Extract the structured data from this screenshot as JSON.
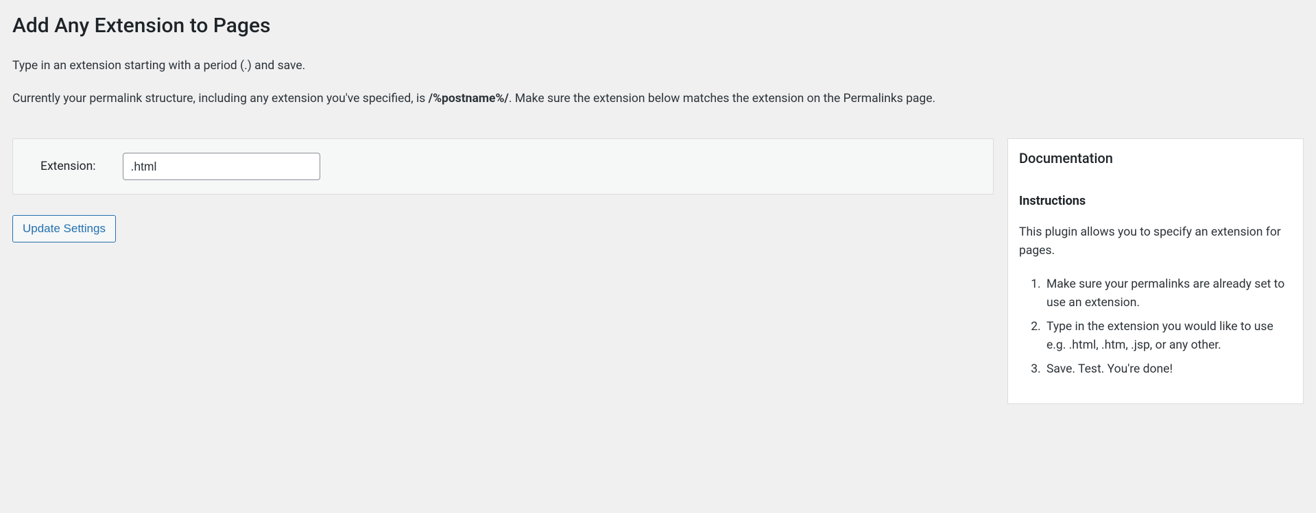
{
  "page": {
    "title": "Add Any Extension to Pages",
    "intro_line1": "Type in an extension starting with a period (.) and save.",
    "intro_line2_prefix": "Currently your permalink structure, including any extension you've specified, is ",
    "permalink_structure": "/%postname%/",
    "intro_line2_suffix": ". Make sure the extension below matches the extension on the Permalinks page."
  },
  "form": {
    "extension_label": "Extension:",
    "extension_value": ".html",
    "update_button_label": "Update Settings"
  },
  "doc": {
    "title": "Documentation",
    "subtitle": "Instructions",
    "description": "This plugin allows you to specify an extension for pages.",
    "steps": [
      "Make sure your permalinks are already set to use an extension.",
      "Type in the extension you would like to use e.g. .html, .htm, .jsp, or any other.",
      "Save. Test. You're done!"
    ]
  }
}
